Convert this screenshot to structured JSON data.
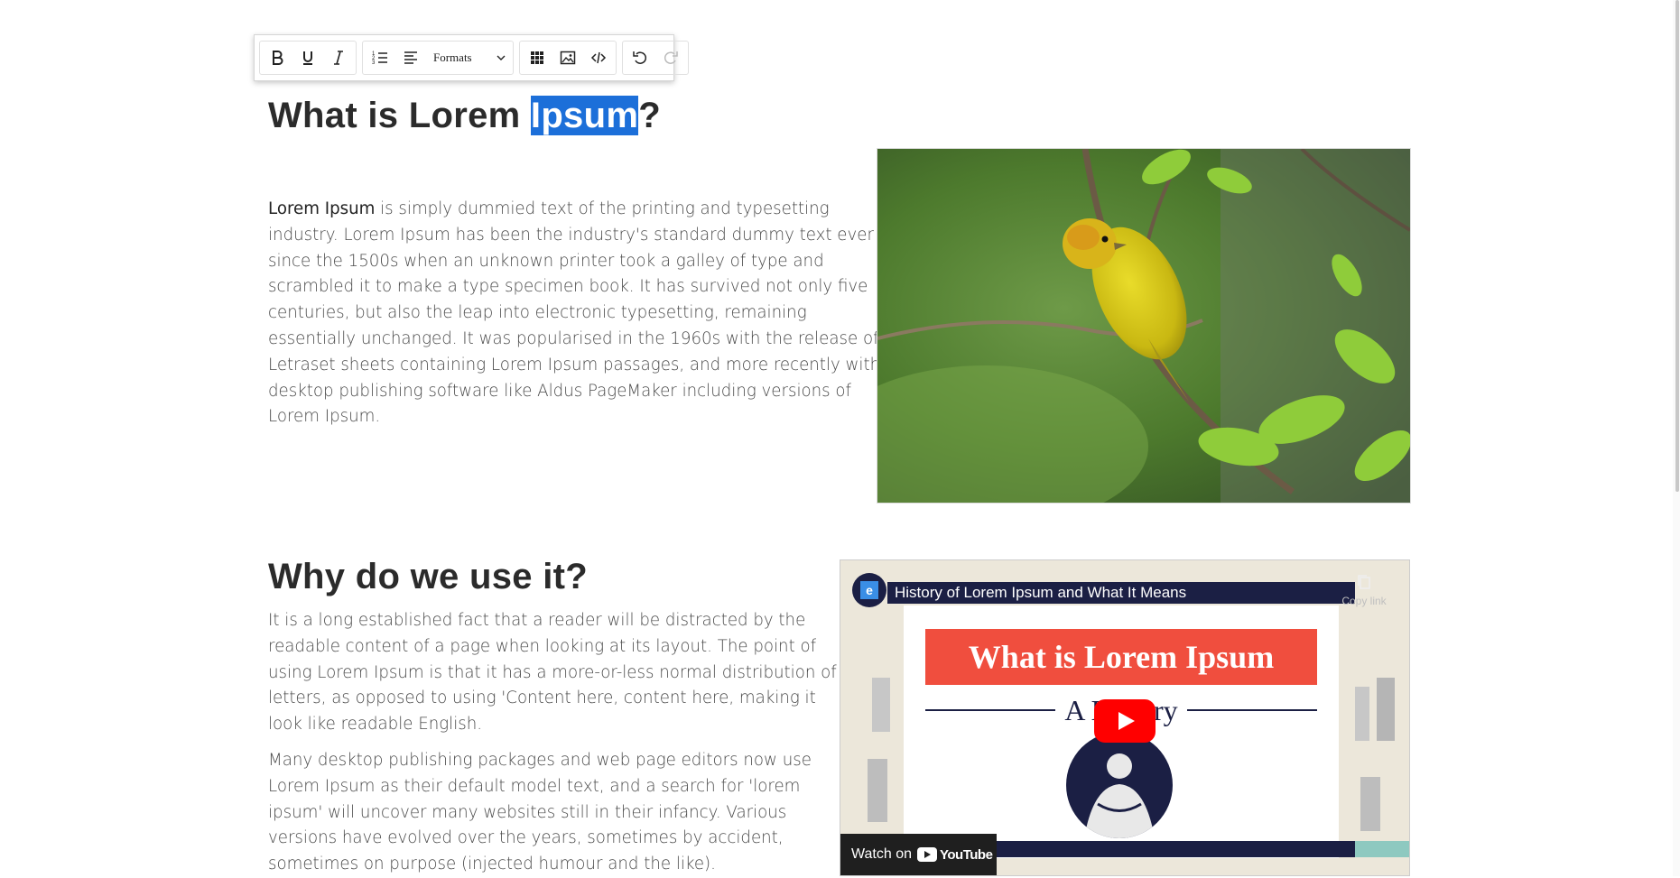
{
  "toolbar": {
    "formats_label": "Formats",
    "buttons": [
      "bold",
      "underline",
      "italic",
      "ordered-list",
      "align",
      "table",
      "image",
      "code",
      "undo",
      "redo"
    ]
  },
  "content": {
    "heading1_before": "What is Lorem ",
    "heading1_selected": "Ipsum",
    "heading1_after": "?",
    "p1_strong": "Lorem Ipsum",
    "p1_rest": " is simply dummied text of the printing and typesetting industry. Lorem Ipsum has been the industry's standard dummy text ever since the 1500s when an unknown printer took a galley of type and scrambled it to make a type specimen book. It has survived not only five centuries, but also the leap into electronic typesetting, remaining essentially unchanged. It was popularised in the 1960s with the release of Letraset sheets containing Lorem Ipsum passages, and more recently with desktop publishing software like Aldus PageMaker including versions of Lorem Ipsum.",
    "heading2": "Why do we use it?",
    "p2": "It is a long established fact that a reader will be distracted by the readable content of a page when looking at its layout. The point of using Lorem Ipsum is that it has a more-or-less normal distribution of letters, as opposed to using 'Content here, content here, making it look like readable English.",
    "p3": "Many desktop publishing packages and web page editors now use Lorem Ipsum as their default model text, and a search for 'lorem ipsum' will uncover many websites still in their infancy. Various versions have evolved over the years, sometimes by accident, sometimes on purpose (injected humour and the like)."
  },
  "video": {
    "title": "History of Lorem Ipsum and What It Means",
    "copy_link": "Copy link",
    "banner": "What is Lorem Ipsum",
    "subtitle": "A History",
    "watch_on": "Watch on",
    "youtube": "YouTube",
    "channel_letter": "e"
  }
}
